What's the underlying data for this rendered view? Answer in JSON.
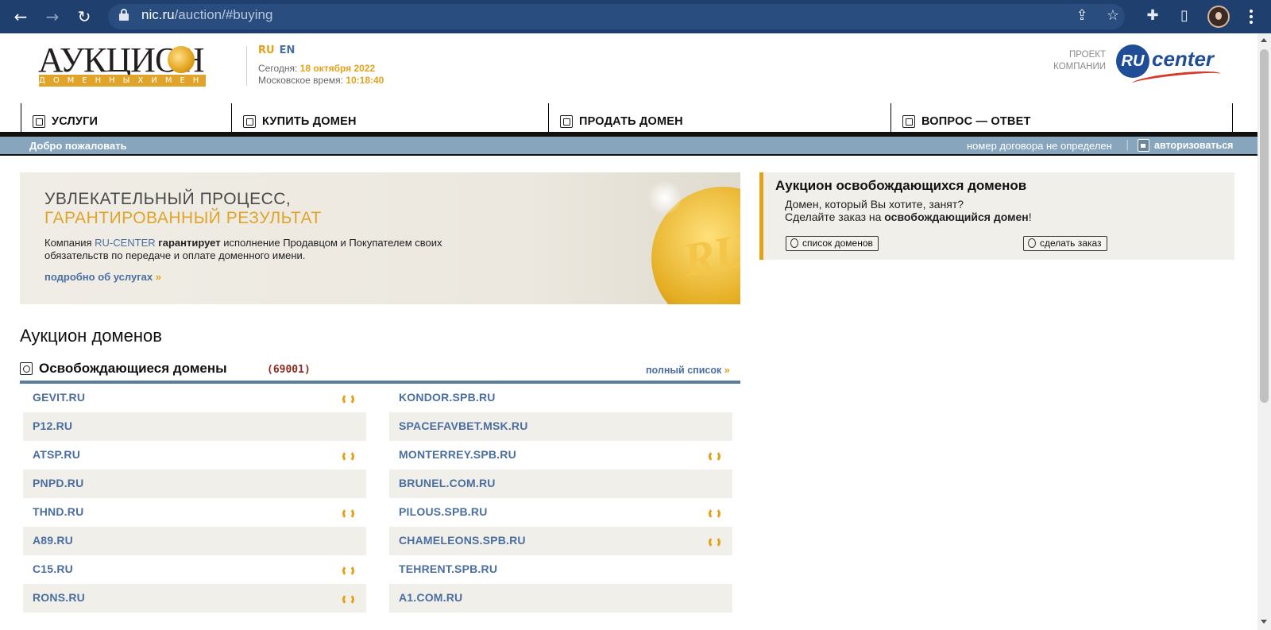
{
  "browser": {
    "url_host": "nic.ru",
    "url_path": "/auction/#buying",
    "icons": [
      "back-icon",
      "forward-icon",
      "reload-icon",
      "lock-icon",
      "share-icon",
      "star-icon",
      "extensions-icon",
      "sidepanel-icon",
      "avatar",
      "menu-icon"
    ]
  },
  "header": {
    "logo_word": "АУКЦИОН",
    "logo_sub": "ДОМЕННЫХИМЕН",
    "lang_ru": "RU",
    "lang_en": "EN",
    "today_label": "Сегодня: ",
    "today_value": "18 октября 2022",
    "time_label": "Московское время: ",
    "time_value": "10:18:40",
    "project_line1": "ПРОЕКТ",
    "project_line2": "КОМПАНИИ",
    "partner_logo_ru": "RU",
    "partner_logo_center": "center"
  },
  "menu": {
    "items": [
      {
        "label": "УСЛУГИ"
      },
      {
        "label": "КУПИТЬ ДОМЕН"
      },
      {
        "label": "ПРОДАТЬ ДОМЕН"
      },
      {
        "label": "ВОПРОС — ОТВЕТ"
      }
    ]
  },
  "strip": {
    "welcome": "Добро пожаловать",
    "contract": "номер договора не определен",
    "separator": "|",
    "login": "авторизоваться"
  },
  "banner": {
    "heading1": "УВЛЕКАТЕЛЬНЫЙ ПРОЦЕСС,",
    "heading2": "ГАРАНТИРОВАННЫЙ РЕЗУЛЬТАТ",
    "body_pre": "Компания ",
    "body_brand": "RU-CENTER",
    "body_bold": "гарантирует",
    "body_post": " исполнение Продавцом и Покупателем своих обязательств по передаче и оплате доменного имени.",
    "more_link": "подробно об услугах",
    "more_arrow": "»",
    "coin_text": "RU"
  },
  "side_panel": {
    "title": "Аукцион освобождающихся доменов",
    "line1": "Домен, который Вы хотите, занят?",
    "line2_pre": "Сделайте заказ на ",
    "line2_bold": "освобождающийся домен",
    "line2_post": "!",
    "btn_list": "список доменов",
    "btn_order": "сделать заказ"
  },
  "auction": {
    "heading": "Аукцион доменов",
    "section_title": "Освобождающиеся домены",
    "section_count": "(69001)",
    "full_list": "полный список",
    "full_list_arrow": "»",
    "left_column": [
      {
        "name": "GEVIT.RU",
        "renew": true
      },
      {
        "name": "P12.RU",
        "renew": false
      },
      {
        "name": "ATSP.RU",
        "renew": true
      },
      {
        "name": "PNPD.RU",
        "renew": false
      },
      {
        "name": "THND.RU",
        "renew": true
      },
      {
        "name": "A89.RU",
        "renew": false
      },
      {
        "name": "C15.RU",
        "renew": true
      },
      {
        "name": "RONS.RU",
        "renew": true
      }
    ],
    "right_column": [
      {
        "name": "KONDOR.SPB.RU",
        "renew": false
      },
      {
        "name": "SPACEFAVBET.MSK.RU",
        "renew": false
      },
      {
        "name": "MONTERREY.SPB.RU",
        "renew": true
      },
      {
        "name": "BRUNEL.COM.RU",
        "renew": false
      },
      {
        "name": "PILOUS.SPB.RU",
        "renew": true
      },
      {
        "name": "CHAMELEONS.SPB.RU",
        "renew": true
      },
      {
        "name": "TEHRENT.SPB.RU",
        "renew": false
      },
      {
        "name": "A1.COM.RU",
        "renew": false
      }
    ]
  },
  "colors": {
    "chrome": "#1f3f6e",
    "accent_gold": "#e2a21a",
    "link_blue": "#4a6ea0",
    "strip_blue": "#87a6bd",
    "row_alt": "#f1efea",
    "count_red": "#8b2a1e"
  }
}
